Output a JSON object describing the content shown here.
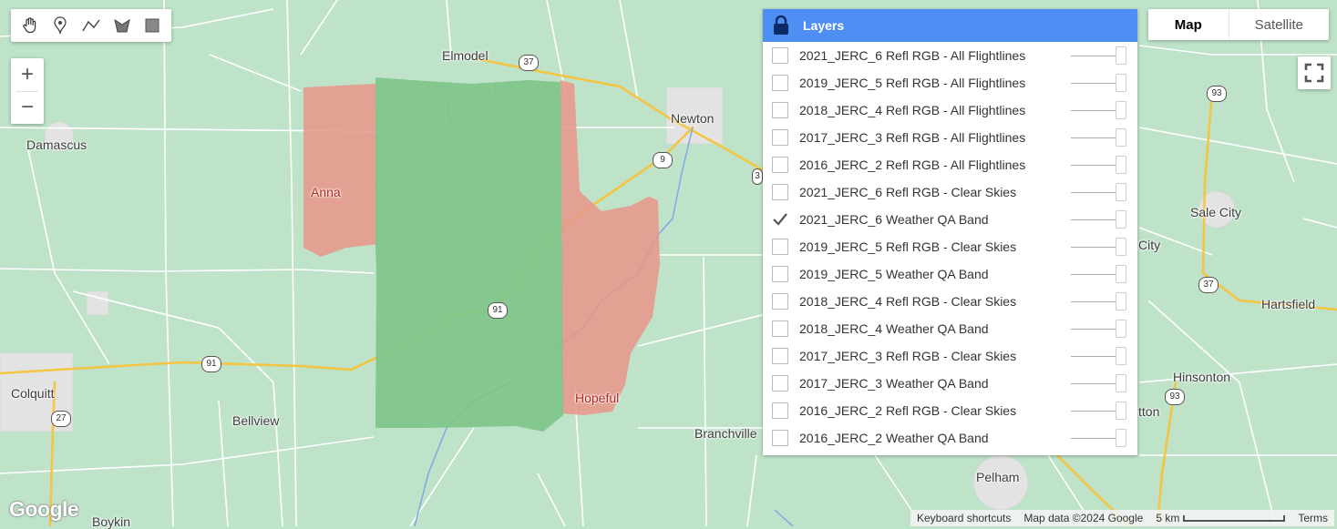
{
  "map": {
    "places": [
      {
        "name": "Elmodel",
        "red": false
      },
      {
        "name": "Newton",
        "red": false
      },
      {
        "name": "Damascus",
        "red": false
      },
      {
        "name": "Anna",
        "red": true
      },
      {
        "name": "Sale City",
        "red": false
      },
      {
        "name": "City",
        "red": false
      },
      {
        "name": "Hartsfield",
        "red": false
      },
      {
        "name": "Colquitt",
        "red": false
      },
      {
        "name": "Bellview",
        "red": false
      },
      {
        "name": "Hopeful",
        "red": true
      },
      {
        "name": "Branchville",
        "red": false
      },
      {
        "name": "Hinsonton",
        "red": false
      },
      {
        "name": "tton",
        "red": false
      },
      {
        "name": "Pelham",
        "red": false
      },
      {
        "name": "Boykin",
        "red": false
      }
    ],
    "shields": [
      "37",
      "9",
      "3",
      "93",
      "91",
      "91",
      "27",
      "37",
      "93"
    ]
  },
  "toolbar": {
    "tools": [
      {
        "name": "pan",
        "icon": "hand-icon"
      },
      {
        "name": "point",
        "icon": "marker-icon"
      },
      {
        "name": "line",
        "icon": "polyline-icon"
      },
      {
        "name": "polygon",
        "icon": "polygon-icon"
      },
      {
        "name": "rectangle",
        "icon": "rectangle-icon"
      }
    ]
  },
  "zoom": {
    "in": "+",
    "out": "−"
  },
  "layers": {
    "title": "Layers",
    "items": [
      {
        "label": "2021_JERC_6 Refl RGB - All Flightlines",
        "checked": false
      },
      {
        "label": "2019_JERC_5 Refl RGB - All Flightlines",
        "checked": false
      },
      {
        "label": "2018_JERC_4 Refl RGB - All Flightlines",
        "checked": false
      },
      {
        "label": "2017_JERC_3 Refl RGB - All Flightlines",
        "checked": false
      },
      {
        "label": "2016_JERC_2 Refl RGB - All Flightlines",
        "checked": false
      },
      {
        "label": "2021_JERC_6 Refl RGB - Clear Skies",
        "checked": false
      },
      {
        "label": "2021_JERC_6 Weather QA Band",
        "checked": true
      },
      {
        "label": "2019_JERC_5 Refl RGB - Clear Skies",
        "checked": false
      },
      {
        "label": "2019_JERC_5 Weather QA Band",
        "checked": false
      },
      {
        "label": "2018_JERC_4 Refl RGB - Clear Skies",
        "checked": false
      },
      {
        "label": "2018_JERC_4 Weather QA Band",
        "checked": false
      },
      {
        "label": "2017_JERC_3 Refl RGB - Clear Skies",
        "checked": false
      },
      {
        "label": "2017_JERC_3 Weather QA Band",
        "checked": false
      },
      {
        "label": "2016_JERC_2 Refl RGB - Clear Skies",
        "checked": false
      },
      {
        "label": "2016_JERC_2 Weather QA Band",
        "checked": false
      }
    ]
  },
  "maptype": {
    "map": "Map",
    "satellite": "Satellite",
    "selected": "Map"
  },
  "footer": {
    "logo": "Google",
    "shortcuts": "Keyboard shortcuts",
    "mapdata": "Map data ©2024 Google",
    "scale": "5 km",
    "terms": "Terms"
  },
  "colors": {
    "accent": "#4f8ef2",
    "overlay_red": "#e8958a",
    "overlay_green": "#7fc48a",
    "map_bg": "#bfe3c9"
  }
}
